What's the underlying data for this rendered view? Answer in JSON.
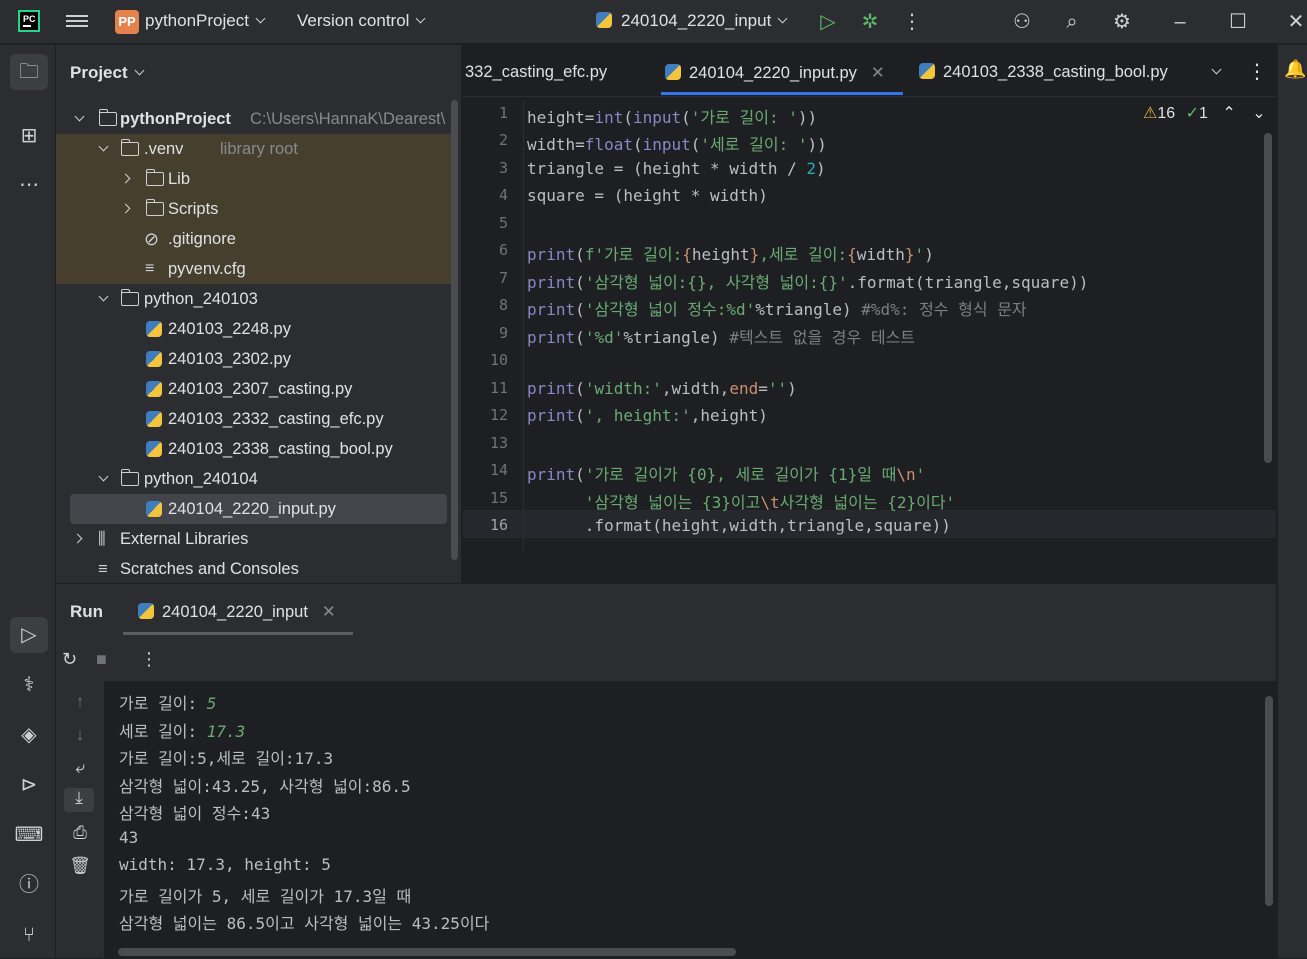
{
  "titlebar": {
    "project_badge": "PP",
    "project_name": "pythonProject",
    "version_control": "Version control",
    "run_config": "240104_2220_input"
  },
  "project_panel": {
    "title": "Project",
    "root_name": "pythonProject",
    "root_path": "C:\\Users\\HannaK\\Dearest\\",
    "items": [
      {
        "label": "pythonProject",
        "hint": "C:\\Users\\HannaK\\Dearest\\"
      },
      {
        "label": ".venv",
        "hint": "library root"
      },
      {
        "label": "Lib"
      },
      {
        "label": "Scripts"
      },
      {
        "label": ".gitignore"
      },
      {
        "label": "pyvenv.cfg"
      },
      {
        "label": "python_240103"
      },
      {
        "label": "240103_2248.py"
      },
      {
        "label": "240103_2302.py"
      },
      {
        "label": "240103_2307_casting.py"
      },
      {
        "label": "240103_2332_casting_efc.py"
      },
      {
        "label": "240103_2338_casting_bool.py"
      },
      {
        "label": "python_240104"
      },
      {
        "label": "240104_2220_input.py"
      },
      {
        "label": "External Libraries"
      },
      {
        "label": "Scratches and Consoles"
      }
    ]
  },
  "editor": {
    "tabs": [
      "332_casting_efc.py",
      "240104_2220_input.py",
      "240103_2338_casting_bool.py"
    ],
    "warnings": "16",
    "checks": "1",
    "line_numbers": [
      "1",
      "2",
      "3",
      "4",
      "5",
      "6",
      "7",
      "8",
      "9",
      "10",
      "11",
      "12",
      "13",
      "14",
      "15",
      "16"
    ]
  },
  "run_panel": {
    "title": "Run",
    "tab": "240104_2220_input",
    "output": {
      "l1_prefix": "가로 길이: ",
      "l1_value": "5",
      "l2_prefix": "세로 길이: ",
      "l2_value": "17.3",
      "l3": "가로 길이:5,세로 길이:17.3",
      "l4": "삼각형 넓이:43.25, 사각형 넓이:86.5",
      "l5": "삼각형 넓이 정수:43",
      "l6": "43",
      "l7": "width: 17.3, height: 5",
      "l8": "가로 길이가 5, 세로 길이가 17.3일 때",
      "l9": "삼각형 넓이는 86.5이고 사각형 넓이는 43.25이다"
    }
  },
  "colors": {
    "accent": "#3574f0",
    "venv_highlight": "#463f2d",
    "string": "#6aab73",
    "keyword": "#8888c6",
    "number": "#2aacb8"
  }
}
